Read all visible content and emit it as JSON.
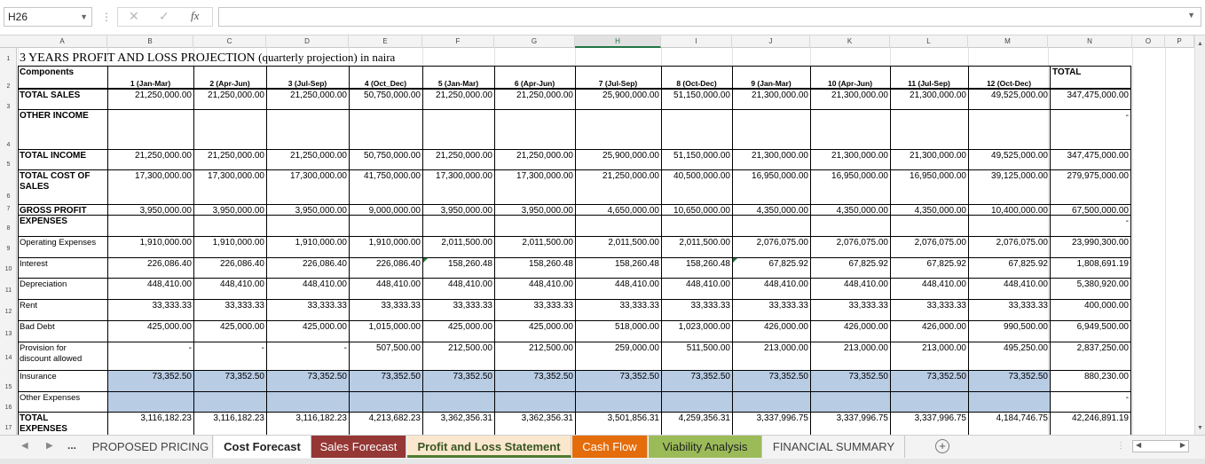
{
  "formula_bar": {
    "cell_ref": "H26",
    "formula": "",
    "cancel_icon": "✕",
    "enter_icon": "✓",
    "fx_label": "fx"
  },
  "columns": [
    "A",
    "B",
    "C",
    "D",
    "E",
    "F",
    "G",
    "H",
    "I",
    "J",
    "K",
    "L",
    "M",
    "N",
    "O",
    "P"
  ],
  "selected_column": "H",
  "rows": [
    "1",
    "2",
    "3",
    "4",
    "5",
    "6",
    "7",
    "8",
    "9",
    "10",
    "11",
    "12",
    "13",
    "14",
    "15",
    "16",
    "17"
  ],
  "sheet": {
    "title": "3 YEARS PROFIT AND LOSS PROJECTION",
    "subtitle": "(quarterly projection) in naira",
    "components_label": "Components",
    "total_label": "TOTAL",
    "quarters": [
      "1 (Jan-Mar)",
      "2 (Apr-Jun)",
      "3 (Jul-Sep)",
      "4 (Oct_Dec)",
      "5 (Jan-Mar)",
      "6 (Apr-Jun)",
      "7 (Jul-Sep)",
      "8 (Oct-Dec)",
      "9 (Jan-Mar)",
      "10 (Apr-Jun)",
      "11 (Jul-Sep)",
      "12 (Oct-Dec)"
    ],
    "lines": [
      {
        "label": "TOTAL SALES",
        "bold": true,
        "values": [
          "21,250,000.00",
          "21,250,000.00",
          "21,250,000.00",
          "50,750,000.00",
          "21,250,000.00",
          "21,250,000.00",
          "25,900,000.00",
          "51,150,000.00",
          "21,300,000.00",
          "21,300,000.00",
          "21,300,000.00",
          "49,525,000.00"
        ],
        "total": "347,475,000.00"
      },
      {
        "label": "OTHER INCOME",
        "bold": true,
        "values": [
          "",
          "",
          "",
          "",
          "",
          "",
          "",
          "",
          "",
          "",
          "",
          ""
        ],
        "total": "-"
      },
      {
        "label": "TOTAL INCOME",
        "bold": true,
        "values": [
          "21,250,000.00",
          "21,250,000.00",
          "21,250,000.00",
          "50,750,000.00",
          "21,250,000.00",
          "21,250,000.00",
          "25,900,000.00",
          "51,150,000.00",
          "21,300,000.00",
          "21,300,000.00",
          "21,300,000.00",
          "49,525,000.00"
        ],
        "total": "347,475,000.00"
      },
      {
        "label": "TOTAL COST OF SALES",
        "label_line1": "TOTAL COST OF",
        "label_line2": "SALES",
        "bold": true,
        "values": [
          "17,300,000.00",
          "17,300,000.00",
          "17,300,000.00",
          "41,750,000.00",
          "17,300,000.00",
          "17,300,000.00",
          "21,250,000.00",
          "40,500,000.00",
          "16,950,000.00",
          "16,950,000.00",
          "16,950,000.00",
          "39,125,000.00"
        ],
        "total": "279,975,000.00"
      },
      {
        "label": "GROSS PROFIT",
        "bold": true,
        "values": [
          "3,950,000.00",
          "3,950,000.00",
          "3,950,000.00",
          "9,000,000.00",
          "3,950,000.00",
          "3,950,000.00",
          "4,650,000.00",
          "10,650,000.00",
          "4,350,000.00",
          "4,350,000.00",
          "4,350,000.00",
          "10,400,000.00"
        ],
        "total": "67,500,000.00"
      },
      {
        "label": "EXPENSES",
        "bold": true,
        "values": [
          "",
          "",
          "",
          "",
          "",
          "",
          "",
          "",
          "",
          "",
          "",
          ""
        ],
        "total": "-"
      },
      {
        "label": "Operating Expenses",
        "bold": false,
        "values": [
          "1,910,000.00",
          "1,910,000.00",
          "1,910,000.00",
          "1,910,000.00",
          "2,011,500.00",
          "2,011,500.00",
          "2,011,500.00",
          "2,011,500.00",
          "2,076,075.00",
          "2,076,075.00",
          "2,076,075.00",
          "2,076,075.00"
        ],
        "total": "23,990,300.00"
      },
      {
        "label": "Interest",
        "bold": false,
        "values": [
          "226,086.40",
          "226,086.40",
          "226,086.40",
          "226,086.40",
          "158,260.48",
          "158,260.48",
          "158,260.48",
          "158,260.48",
          "67,825.92",
          "67,825.92",
          "67,825.92",
          "67,825.92"
        ],
        "total": "1,808,691.19"
      },
      {
        "label": "Depreciation",
        "bold": false,
        "values": [
          "448,410.00",
          "448,410.00",
          "448,410.00",
          "448,410.00",
          "448,410.00",
          "448,410.00",
          "448,410.00",
          "448,410.00",
          "448,410.00",
          "448,410.00",
          "448,410.00",
          "448,410.00"
        ],
        "total": "5,380,920.00"
      },
      {
        "label": "Rent",
        "bold": false,
        "values": [
          "33,333.33",
          "33,333.33",
          "33,333.33",
          "33,333.33",
          "33,333.33",
          "33,333.33",
          "33,333.33",
          "33,333.33",
          "33,333.33",
          "33,333.33",
          "33,333.33",
          "33,333.33"
        ],
        "total": "400,000.00"
      },
      {
        "label": "Bad Debt",
        "bold": false,
        "values": [
          "425,000.00",
          "425,000.00",
          "425,000.00",
          "1,015,000.00",
          "425,000.00",
          "425,000.00",
          "518,000.00",
          "1,023,000.00",
          "426,000.00",
          "426,000.00",
          "426,000.00",
          "990,500.00"
        ],
        "total": "6,949,500.00"
      },
      {
        "label": "Provision for discount allowed",
        "label_line1": "Provision for",
        "label_line2": "discount allowed",
        "bold": false,
        "values": [
          "-",
          "-",
          "-",
          "507,500.00",
          "212,500.00",
          "212,500.00",
          "259,000.00",
          "511,500.00",
          "213,000.00",
          "213,000.00",
          "213,000.00",
          "495,250.00"
        ],
        "total": "2,837,250.00"
      },
      {
        "label": "Insurance",
        "bold": false,
        "values": [
          "73,352.50",
          "73,352.50",
          "73,352.50",
          "73,352.50",
          "73,352.50",
          "73,352.50",
          "73,352.50",
          "73,352.50",
          "73,352.50",
          "73,352.50",
          "73,352.50",
          "73,352.50"
        ],
        "total": "880,230.00"
      },
      {
        "label": "Other Expenses",
        "bold": false,
        "values": [
          "",
          "",
          "",
          "",
          "",
          "",
          "",
          "",
          "",
          "",
          "",
          ""
        ],
        "total": "-"
      },
      {
        "label": "TOTAL EXPENSES",
        "label_line1": "TOTAL",
        "label_line2": "EXPENSES",
        "bold": true,
        "values": [
          "3,116,182.23",
          "3,116,182.23",
          "3,116,182.23",
          "4,213,682.23",
          "3,362,356.31",
          "3,362,356.31",
          "3,501,856.31",
          "4,259,356.31",
          "3,337,996.75",
          "3,337,996.75",
          "3,337,996.75",
          "4,184,746.75"
        ],
        "total": "42,246,891.19"
      }
    ]
  },
  "tabs": {
    "more": "...",
    "items": [
      {
        "label": "PROPOSED PRICING",
        "style": "plain"
      },
      {
        "label": "Cost Forecast",
        "style": "active"
      },
      {
        "label": "Sales Forecast",
        "style": "red"
      },
      {
        "label": "Profit and Loss Statement",
        "style": "tan"
      },
      {
        "label": "Cash Flow",
        "style": "orange"
      },
      {
        "label": "Viability Analysis",
        "style": "green"
      },
      {
        "label": "FINANCIAL SUMMARY",
        "style": "plain"
      }
    ],
    "add_icon": "+"
  },
  "colors": {
    "excel_green": "#217346",
    "highlight_blue": "#b8cce4",
    "tab_red": "#953735",
    "tab_orange": "#e46c0a",
    "tab_green": "#9bbb59",
    "tab_tan": "#fbe7ce"
  }
}
